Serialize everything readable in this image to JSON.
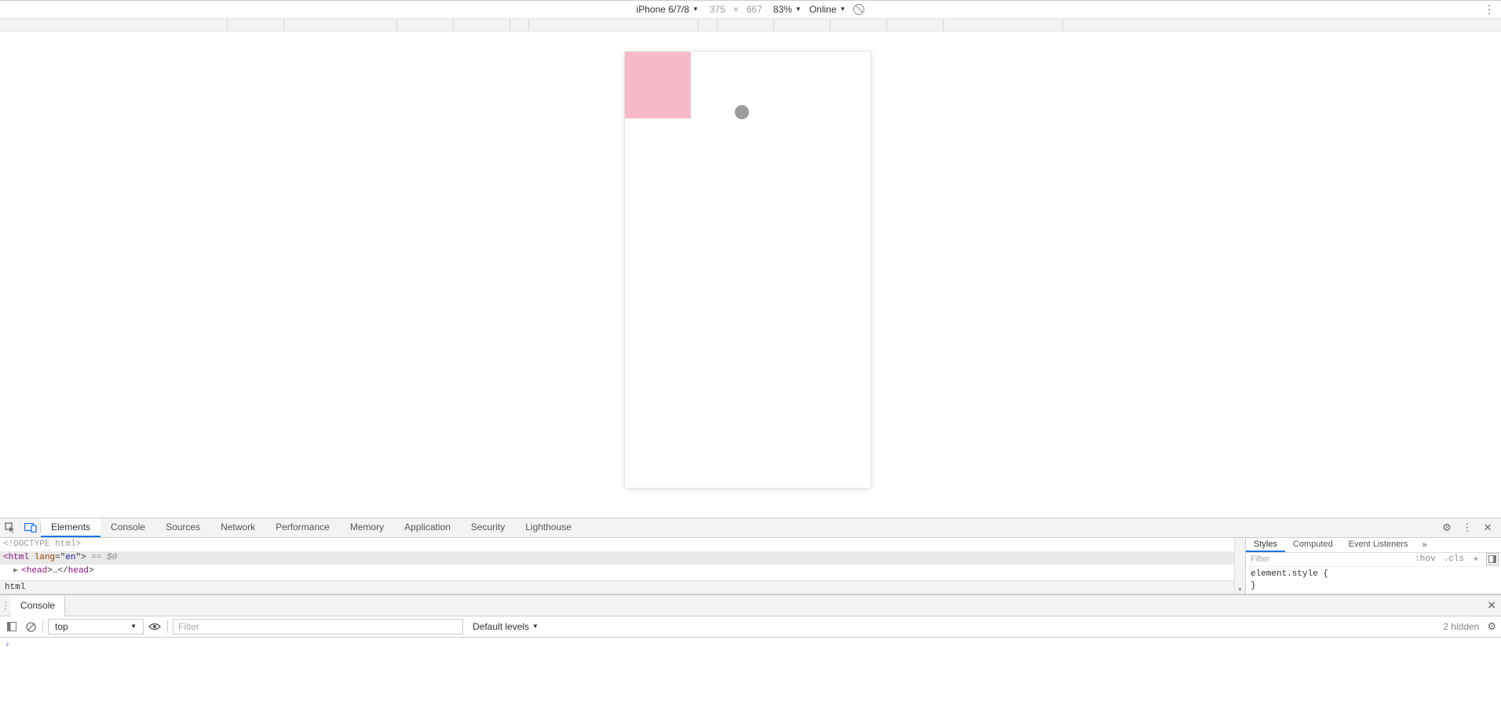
{
  "device_toolbar": {
    "device": "iPhone 6/7/8",
    "width": "375",
    "x": "×",
    "height": "667",
    "zoom": "83%",
    "throttle": "Online"
  },
  "ruler_ticks": [
    290,
    72,
    144,
    72,
    72,
    24,
    216,
    24,
    72,
    72,
    72,
    72,
    152
  ],
  "devtools_tabs": {
    "elements": "Elements",
    "console": "Console",
    "sources": "Sources",
    "network": "Network",
    "performance": "Performance",
    "memory": "Memory",
    "application": "Application",
    "security": "Security",
    "lighthouse": "Lighthouse"
  },
  "dom_tree": {
    "line0": "<!DOCTYPE html>",
    "line1_open": "<",
    "line1_tag": "html",
    "line1_attr": " lang",
    "line1_eq": "=\"",
    "line1_val": "en",
    "line1_close": "\">",
    "line1_sel": " == $0",
    "line2_open": "<",
    "line2_tag": "head",
    "line2_mid": ">…</",
    "line2_tag2": "head",
    "line2_end": ">",
    "breadcrumb": "html"
  },
  "styles": {
    "tab_styles": "Styles",
    "tab_computed": "Computed",
    "tab_events": "Event Listeners",
    "more": "»",
    "filter_placeholder": "Filter",
    "hov": ":hov",
    "cls": ".cls",
    "plus": "+",
    "rule_open": "element.style {",
    "rule_close": "}"
  },
  "console_header": {
    "tab": "Console"
  },
  "console_toolbar": {
    "context": "top",
    "filter_placeholder": "Filter",
    "levels": "Default levels",
    "hidden": "2 hidden"
  },
  "console_body": {
    "prompt": "›"
  }
}
